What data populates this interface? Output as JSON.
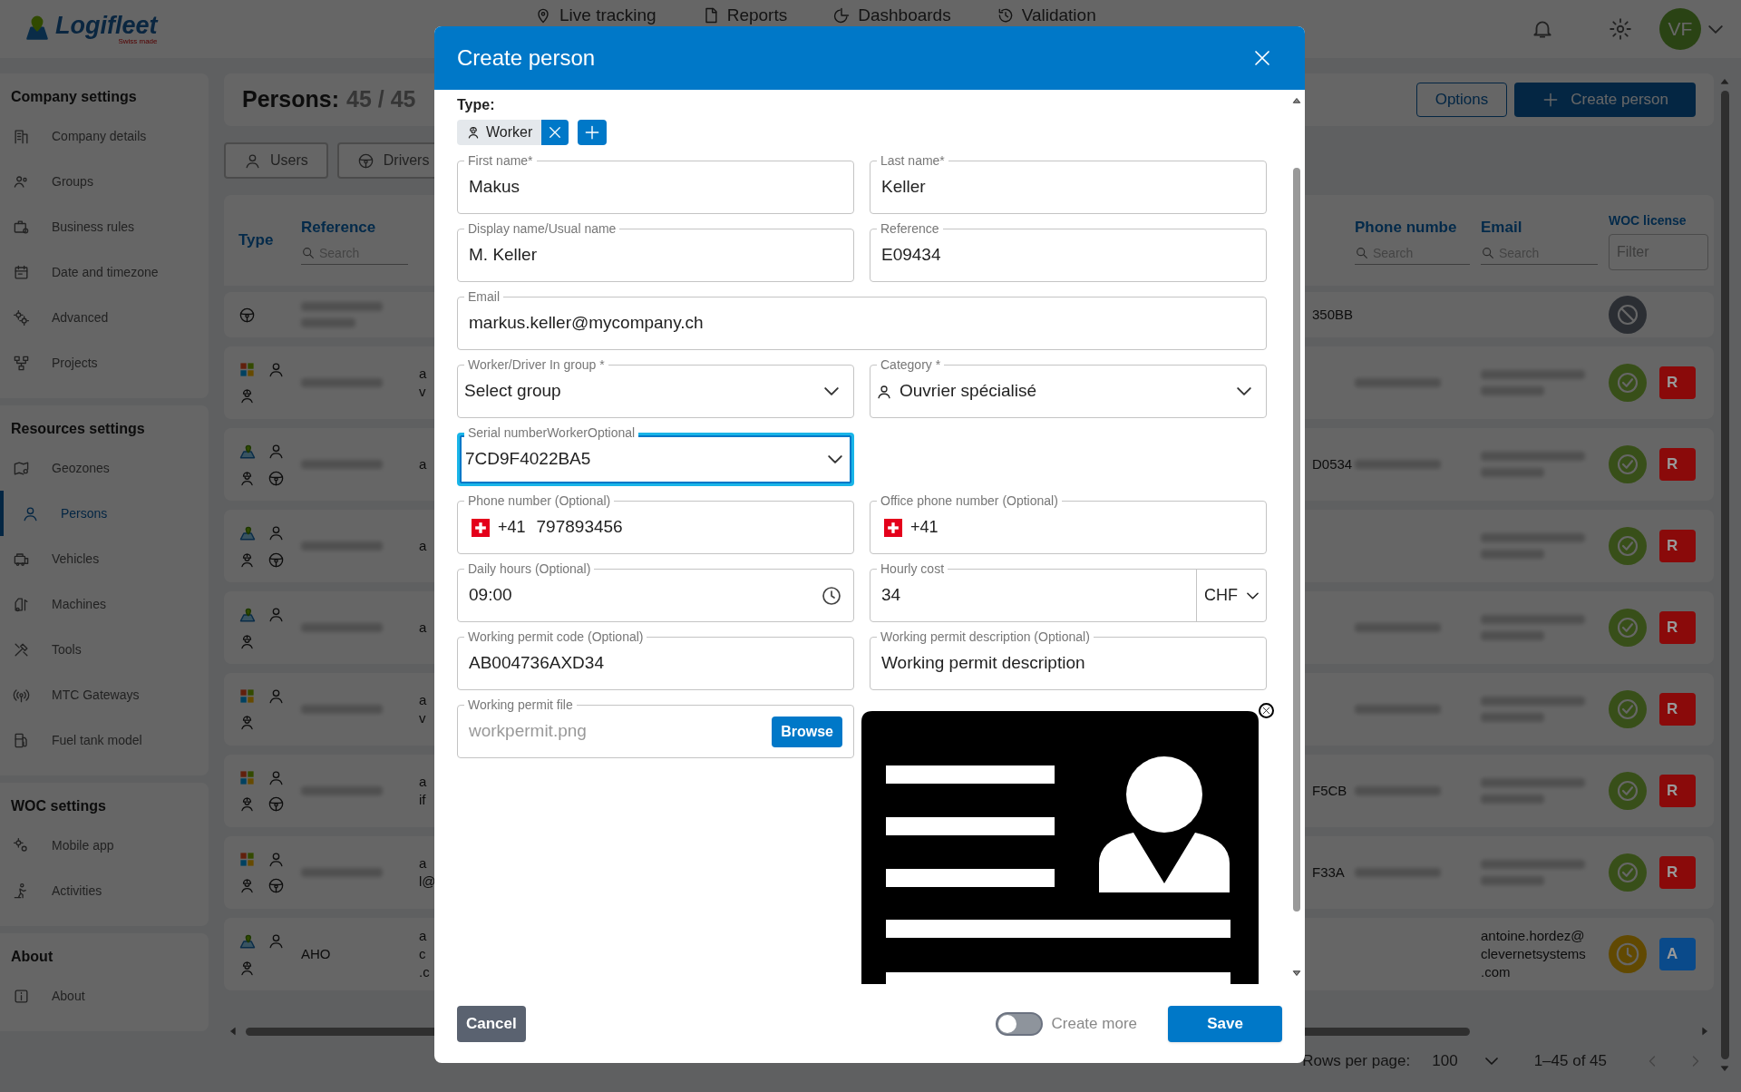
{
  "header": {
    "logo": "Logifleet",
    "tagline": "Swiss made",
    "nav": [
      {
        "label": "Live tracking"
      },
      {
        "label": "Reports"
      },
      {
        "label": "Dashboards"
      },
      {
        "label": "Validation"
      }
    ],
    "avatar": "VF"
  },
  "sidebar": [
    {
      "title": "Company settings",
      "items": [
        {
          "label": "Company details",
          "selected": false
        },
        {
          "label": "Groups",
          "selected": false
        },
        {
          "label": "Business rules",
          "selected": false
        },
        {
          "label": "Date and timezone",
          "selected": false
        },
        {
          "label": "Advanced",
          "selected": false
        },
        {
          "label": "Projects",
          "selected": false
        }
      ]
    },
    {
      "title": "Resources settings",
      "items": [
        {
          "label": "Geozones",
          "selected": false
        },
        {
          "label": "Persons",
          "selected": true
        },
        {
          "label": "Vehicles",
          "selected": false
        },
        {
          "label": "Machines",
          "selected": false
        },
        {
          "label": "Tools",
          "selected": false
        },
        {
          "label": "MTC Gateways",
          "selected": false
        },
        {
          "label": "Fuel tank model",
          "selected": false
        }
      ]
    },
    {
      "title": "WOC settings",
      "items": [
        {
          "label": "Mobile app",
          "selected": false
        },
        {
          "label": "Activities",
          "selected": false
        }
      ]
    },
    {
      "title": "About",
      "items": [
        {
          "label": "About",
          "selected": false
        }
      ]
    }
  ],
  "page": {
    "title": "Persons:",
    "count": "45 / 45",
    "options_button": "Options",
    "create_button": "Create person",
    "filters": [
      {
        "label": "Users"
      },
      {
        "label": "Drivers"
      }
    ]
  },
  "table": {
    "columns": [
      {
        "label": "Type"
      },
      {
        "label": "Reference",
        "kind": "search",
        "placeholder": "Search"
      },
      {
        "label": "Phone numbe",
        "kind": "search",
        "placeholder": "Search"
      },
      {
        "label": "Email",
        "kind": "search",
        "placeholder": "Search"
      },
      {
        "label": "WOC license",
        "kind": "filter",
        "placeholder": "Filter"
      }
    ],
    "rows": [
      {
        "roles": [
          {
            "kind": "driver"
          }
        ],
        "blurred": {
          "reference": true
        },
        "id": "350BB",
        "license": {
          "kind": "none"
        }
      },
      {
        "roles": [
          {
            "kind": "microsoft"
          },
          {
            "kind": "user"
          },
          {
            "kind": "worker"
          }
        ],
        "blurred": {
          "reference": true,
          "phone": true,
          "email": true
        },
        "column_3": [
          "a",
          "v"
        ],
        "license": {
          "kind": "active"
        },
        "action": {
          "label": "R",
          "color": "#8a0a0a"
        }
      },
      {
        "roles": [
          {
            "kind": "woc"
          },
          {
            "kind": "user"
          },
          {
            "kind": "worker"
          },
          {
            "kind": "driver"
          }
        ],
        "blurred": {
          "reference": true,
          "phone": true,
          "email": true
        },
        "column_3": [
          "a"
        ],
        "id": "D0534",
        "license": {
          "kind": "active"
        },
        "action": {
          "label": "R",
          "color": "#8a0a0a"
        }
      },
      {
        "roles": [
          {
            "kind": "woc"
          },
          {
            "kind": "user"
          },
          {
            "kind": "worker"
          },
          {
            "kind": "driver"
          }
        ],
        "blurred": {
          "reference": true,
          "email": true
        },
        "column_3": [
          "a"
        ],
        "license": {
          "kind": "active"
        },
        "action": {
          "label": "R",
          "color": "#8a0a0a"
        }
      },
      {
        "roles": [
          {
            "kind": "woc"
          },
          {
            "kind": "user"
          },
          {
            "kind": "worker"
          }
        ],
        "blurred": {
          "reference": true,
          "phone": true,
          "email": true
        },
        "column_3": [
          "a"
        ],
        "license": {
          "kind": "active"
        },
        "action": {
          "label": "R",
          "color": "#8a0a0a"
        }
      },
      {
        "roles": [
          {
            "kind": "microsoft"
          },
          {
            "kind": "user"
          },
          {
            "kind": "worker"
          }
        ],
        "blurred": {
          "reference": true,
          "phone": true,
          "email": true
        },
        "column_3": [
          "a",
          "v"
        ],
        "license": {
          "kind": "active"
        },
        "action": {
          "label": "R",
          "color": "#8a0a0a"
        }
      },
      {
        "roles": [
          {
            "kind": "microsoft"
          },
          {
            "kind": "user"
          },
          {
            "kind": "worker"
          },
          {
            "kind": "driver"
          }
        ],
        "blurred": {
          "reference": true,
          "phone": true,
          "email": true
        },
        "column_3": [
          "a",
          "if"
        ],
        "id": "F5CB",
        "license": {
          "kind": "active"
        },
        "action": {
          "label": "R",
          "color": "#8a0a0a"
        }
      },
      {
        "roles": [
          {
            "kind": "microsoft"
          },
          {
            "kind": "user"
          },
          {
            "kind": "worker"
          },
          {
            "kind": "driver"
          }
        ],
        "blurred": {
          "reference": true,
          "phone": true,
          "email": true
        },
        "column_3": [
          "a",
          "l@"
        ],
        "id": "F33A",
        "license": {
          "kind": "active"
        },
        "action": {
          "label": "R",
          "color": "#8a0a0a"
        }
      },
      {
        "roles": [
          {
            "kind": "woc"
          },
          {
            "kind": "user"
          },
          {
            "kind": "worker"
          }
        ],
        "reference": "AHO",
        "column_3": [
          "a",
          "c",
          ".c"
        ],
        "email": "antoine.hordez@ clevernetsystems .com",
        "license": {
          "kind": "pending"
        },
        "action": {
          "label": "A",
          "color": "#0a4a8a"
        }
      }
    ],
    "pagination": {
      "label": "Rows per page:",
      "rows_per_page": "100",
      "range": "1–45 of 45"
    }
  },
  "dialog": {
    "title": "Create person",
    "type_label": "Type:",
    "type_chips": [
      {
        "label": "Worker"
      }
    ],
    "rows": [
      [
        {
          "kind": "text",
          "label": "First name*",
          "value": "Makus"
        },
        {
          "kind": "text",
          "label": "Last name*",
          "value": "Keller"
        }
      ],
      [
        {
          "kind": "text",
          "label": "Display name/Usual name",
          "value": "M. Keller"
        },
        {
          "kind": "text",
          "label": "Reference",
          "value": "E09434"
        }
      ],
      [
        {
          "kind": "text",
          "label": "Email",
          "value": "markus.keller@mycompany.ch"
        }
      ],
      [
        {
          "kind": "select",
          "label": "Worker/Driver In group *",
          "value": "Select group"
        },
        {
          "kind": "person_select",
          "label": "Category *",
          "value": "Ouvrier spécialisé"
        }
      ],
      [
        {
          "kind": "select",
          "label": "Serial numberWorkerOptional",
          "value": "7CD9F4022BA5",
          "focused": true
        }
      ],
      [
        {
          "kind": "phone",
          "label": "Phone number (Optional)",
          "prefix": "+41",
          "value": "797893456"
        },
        {
          "kind": "phone",
          "label": "Office phone number (Optional)",
          "prefix": "+41"
        }
      ],
      [
        {
          "kind": "time",
          "label": "Daily hours (Optional)",
          "value": "09:00"
        },
        {
          "kind": "currency",
          "label": "Hourly cost",
          "value": "34",
          "currency": "CHF"
        }
      ],
      [
        {
          "kind": "text",
          "label": "Working permit code (Optional)",
          "value": "AB004736AXD34"
        },
        {
          "kind": "text",
          "label": "Working permit description (Optional)",
          "value": "Working permit description"
        }
      ],
      [
        {
          "kind": "file",
          "label": "Working permit file",
          "placeholder": "workpermit.png",
          "button": "Browse"
        }
      ]
    ],
    "preview": {
      "kind": "picture"
    },
    "cancel": "Cancel",
    "create_more": {
      "label": "Create more",
      "on": false
    },
    "save": "Save"
  }
}
